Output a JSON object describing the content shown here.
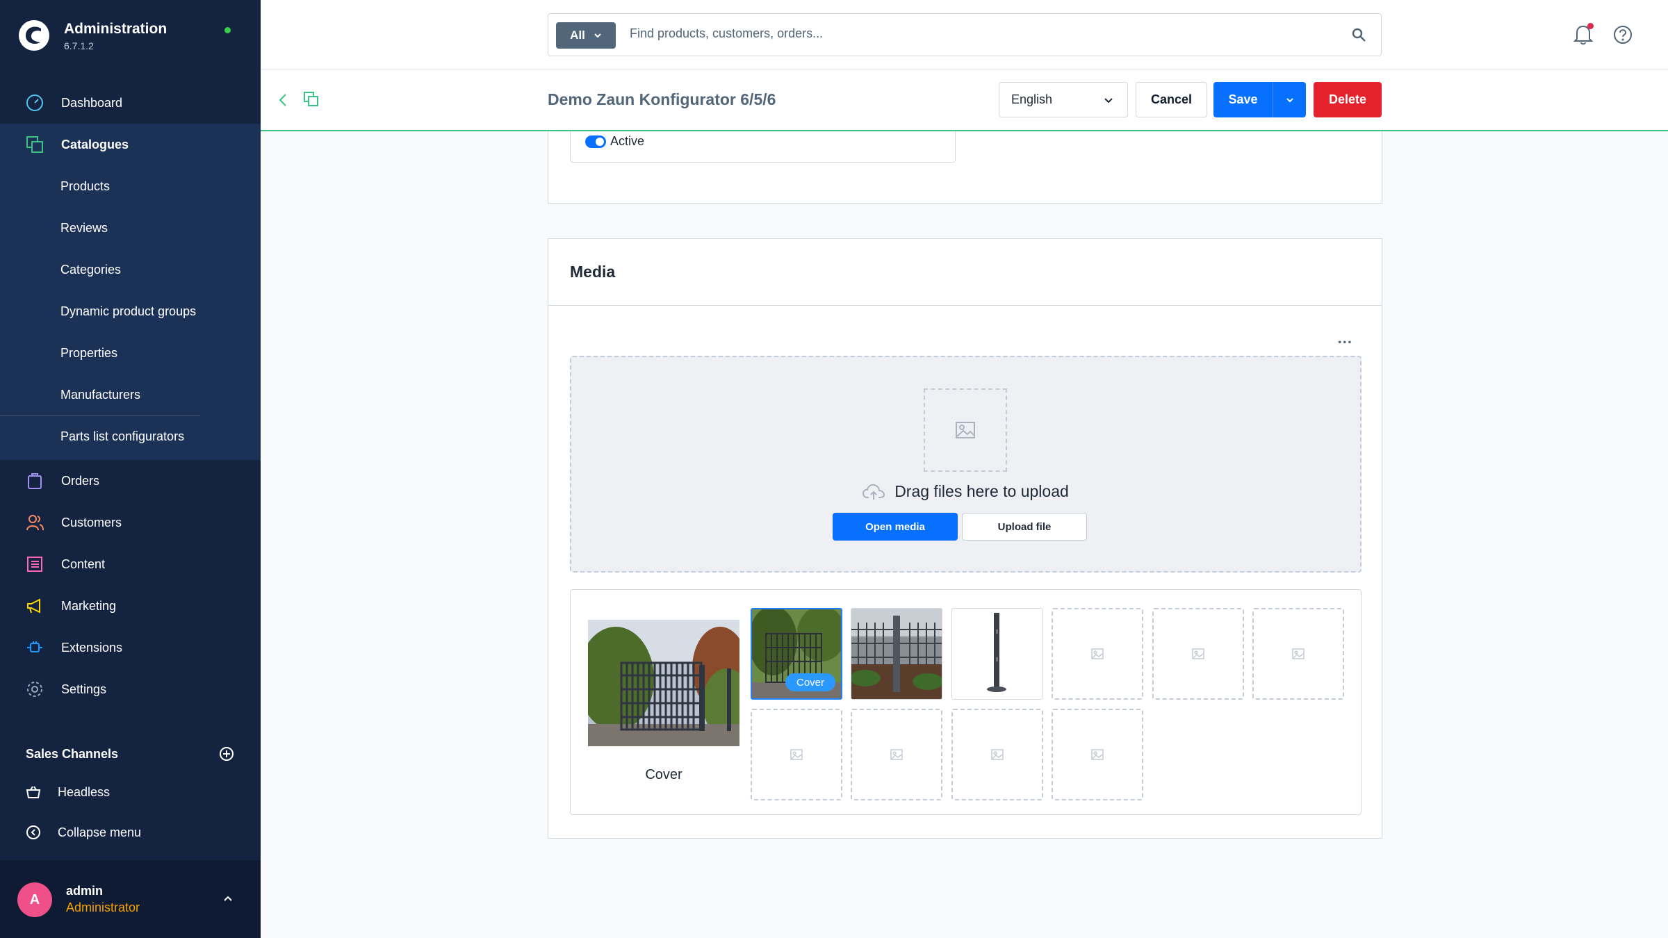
{
  "app": {
    "title": "Administration",
    "version": "6.7.1.2"
  },
  "search": {
    "scope_label": "All",
    "placeholder": "Find products, customers, orders..."
  },
  "sidebar": {
    "items": [
      {
        "label": "Dashboard",
        "icon": "gauge-icon"
      },
      {
        "label": "Catalogues",
        "icon": "catalogue-icon"
      },
      {
        "label": "Orders",
        "icon": "shopping-bag-icon"
      },
      {
        "label": "Customers",
        "icon": "users-icon"
      },
      {
        "label": "Content",
        "icon": "content-icon"
      },
      {
        "label": "Marketing",
        "icon": "megaphone-icon"
      },
      {
        "label": "Extensions",
        "icon": "plug-icon"
      },
      {
        "label": "Settings",
        "icon": "gear-icon"
      }
    ],
    "catalogue_sub": [
      "Products",
      "Reviews",
      "Categories",
      "Dynamic product groups",
      "Properties",
      "Manufacturers",
      "Parts list configurators"
    ],
    "sales_channels_title": "Sales Channels",
    "sales_channels": [
      "Headless"
    ],
    "collapse_label": "Collapse menu"
  },
  "user": {
    "initial": "A",
    "name": "admin",
    "role": "Administrator"
  },
  "smartbar": {
    "title": "Demo Zaun Konfigurator 6/5/6",
    "language": "English",
    "cancel_label": "Cancel",
    "save_label": "Save",
    "delete_label": "Delete"
  },
  "product": {
    "active_label": "Active"
  },
  "media": {
    "title": "Media",
    "more_label": "...",
    "dropzone_text": "Drag files here to upload",
    "open_media_label": "Open media",
    "upload_file_label": "Upload file",
    "cover_caption": "Cover",
    "cover_badge": "Cover"
  },
  "colors": {
    "sidebar_bg": "#132340",
    "primary": "#0870ff",
    "danger": "#e3222d",
    "accent_line": "#3cc183"
  }
}
